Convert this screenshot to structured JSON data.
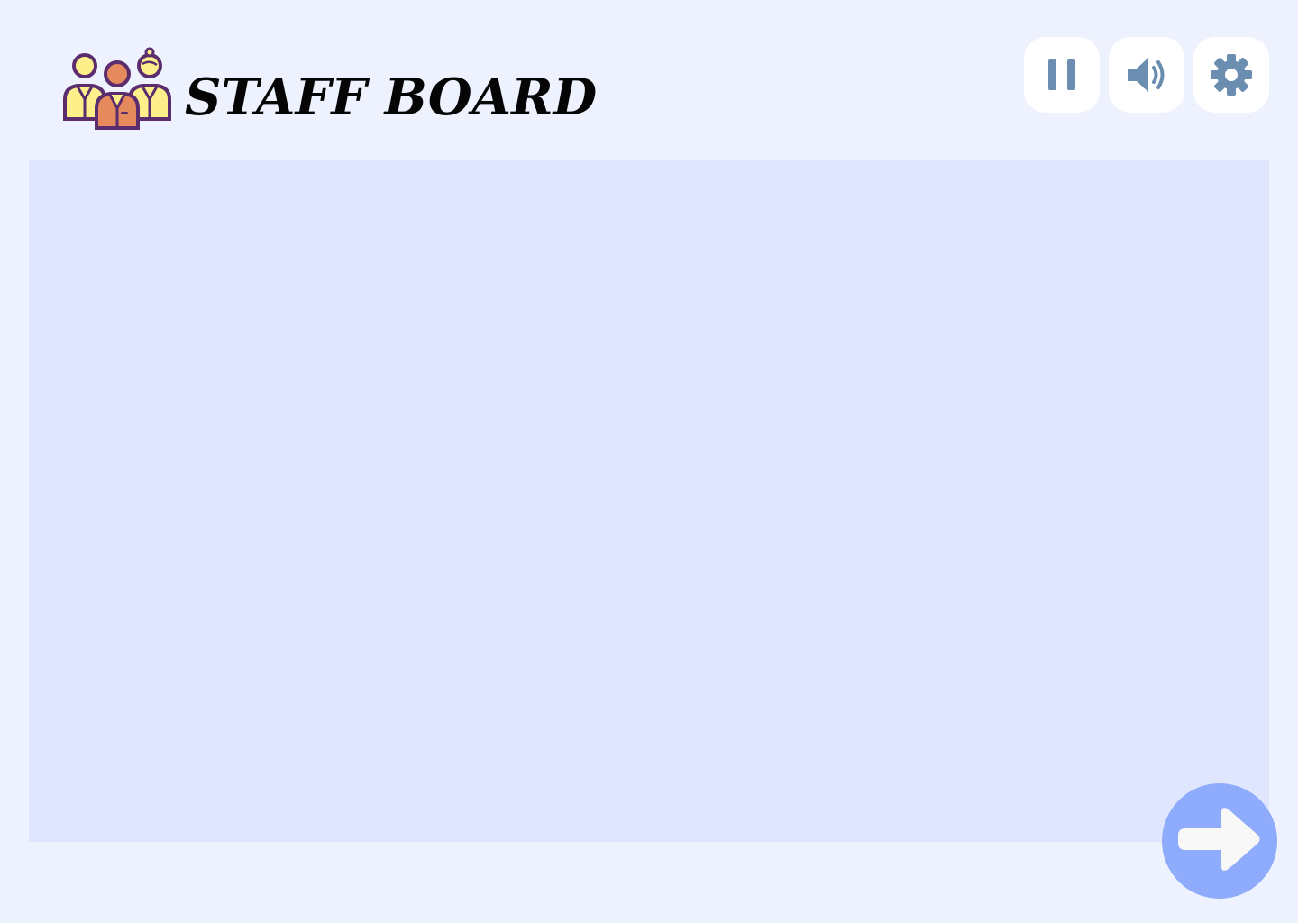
{
  "header": {
    "title": "STAFF BOARD",
    "logo_icon": "staff-group-icon"
  },
  "controls": {
    "pause_icon": "pause-icon",
    "sound_icon": "speaker-volume-icon",
    "settings_icon": "gear-icon"
  },
  "navigation": {
    "next_icon": "arrow-right-icon"
  },
  "colors": {
    "page_background": "#eef2fe",
    "board_background": "#e0e6fd",
    "control_button_bg": "#ffffff",
    "control_icon": "#6b8db0",
    "next_button_bg": "#8fabfc",
    "next_arrow": "#f8f8f8",
    "title_text": "#050505",
    "logo_outline": "#5b2d6e",
    "logo_yellow": "#fdf08a",
    "logo_orange": "#e58a5c"
  }
}
